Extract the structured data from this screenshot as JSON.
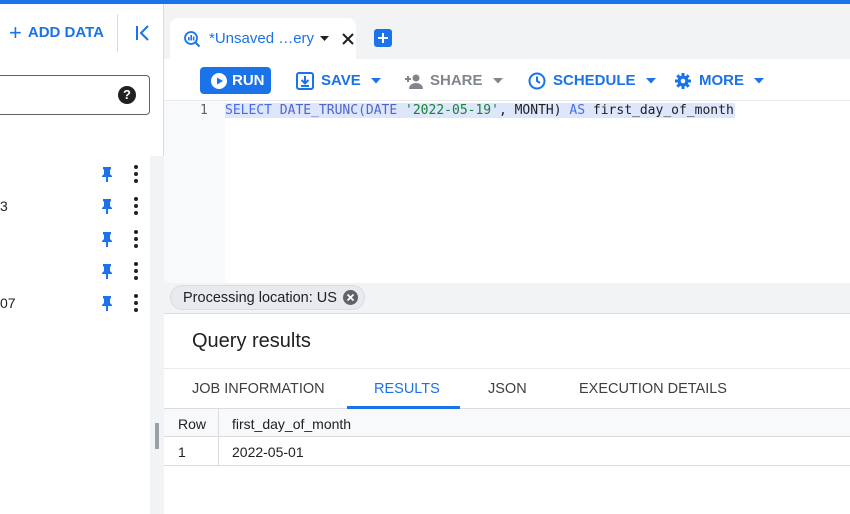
{
  "left_panel": {
    "add_data_label": "ADD DATA",
    "help_glyph": "?",
    "tree_fragments": [
      "",
      "3",
      "",
      "",
      "07"
    ]
  },
  "tab": {
    "label": "*Unsaved …ery"
  },
  "toolbar": {
    "run_label": "RUN",
    "save_label": "SAVE",
    "share_label": "SHARE",
    "schedule_label": "SCHEDULE",
    "more_label": "MORE"
  },
  "editor": {
    "line_number": "1",
    "tokens": {
      "select": "SELECT",
      "date_trunc": "DATE_TRUNC(",
      "date": "DATE",
      "literal": "'2022-05-19'",
      "comma": ",",
      "month": "MONTH)",
      "as": "AS",
      "alias": "first_day_of_month"
    }
  },
  "processing_location": "Processing location: US",
  "results": {
    "title": "Query results",
    "tabs": [
      "JOB INFORMATION",
      "RESULTS",
      "JSON",
      "EXECUTION DETAILS"
    ],
    "active_tab": "RESULTS",
    "columns": [
      "Row",
      "first_day_of_month"
    ],
    "rows": [
      [
        "1",
        "2022-05-01"
      ]
    ]
  },
  "colors": {
    "accent": "#1a73e8",
    "disabled": "#80868b",
    "string_literal": "#188038"
  },
  "icons": [
    "plus-icon",
    "collapse-panel-icon",
    "help-icon",
    "pin-icon",
    "more-vert-icon",
    "query-icon",
    "caret-down-icon",
    "close-icon",
    "add-tab-icon",
    "play-icon",
    "save-icon",
    "share-person-icon",
    "schedule-clock-icon",
    "settings-gear-icon",
    "chip-cancel-icon"
  ]
}
